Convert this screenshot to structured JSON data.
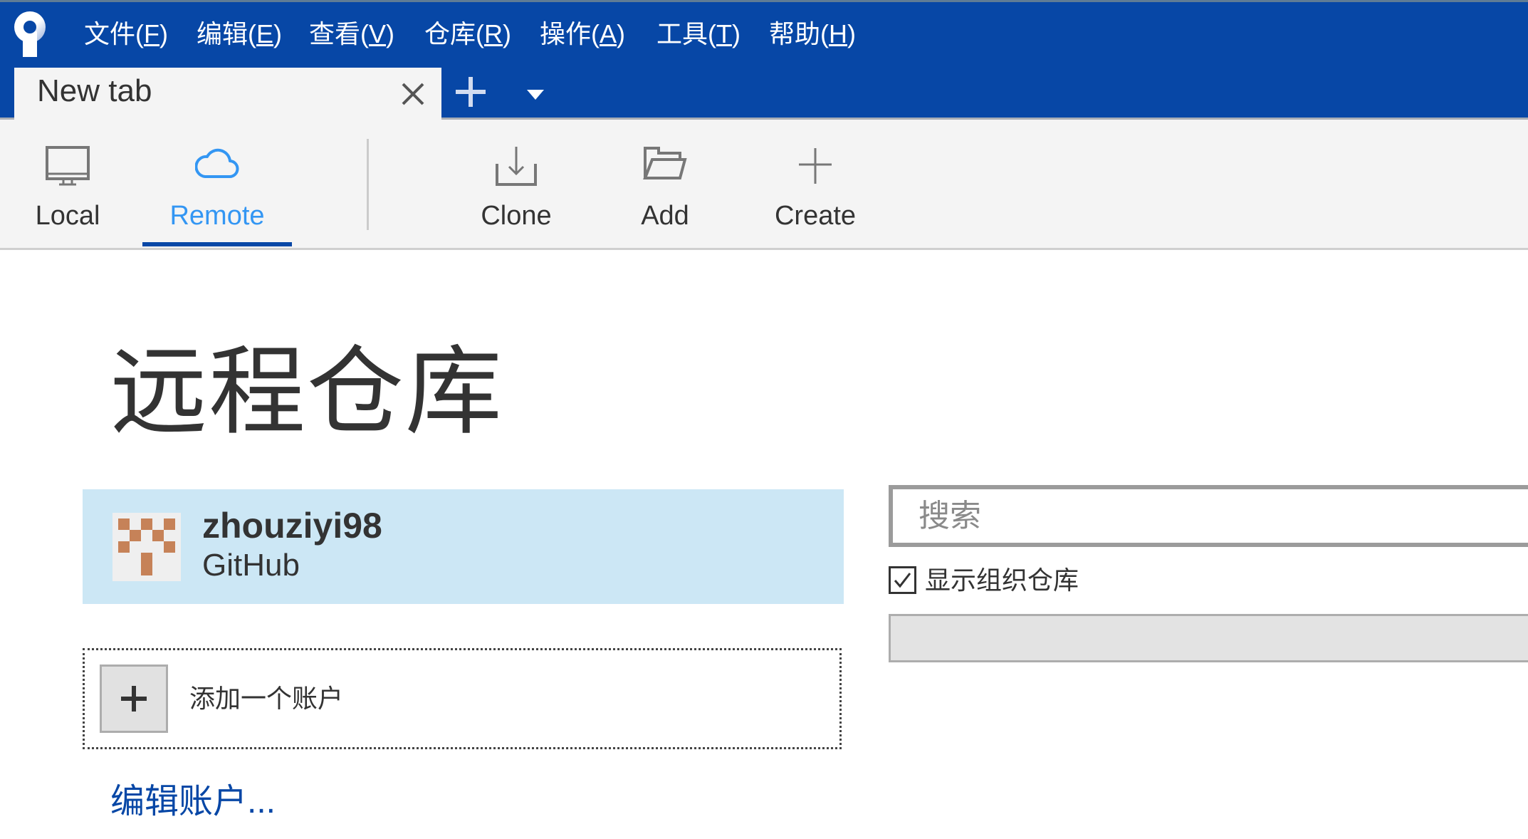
{
  "colors": {
    "chrome_blue": "#0747A6",
    "toolbar_bg": "#F4F4F4",
    "selected_account_bg": "#CCE7F5",
    "remote_accent": "#3396F3",
    "link_blue": "#0747A6",
    "avatar_orange": "#C68258"
  },
  "app": {
    "logo_icon": "sourcetree-logo-icon"
  },
  "menu": {
    "items": [
      {
        "label": "文件(F)",
        "mnemonic": "F"
      },
      {
        "label": "编辑(E)",
        "mnemonic": "E"
      },
      {
        "label": "查看(V)",
        "mnemonic": "V"
      },
      {
        "label": "仓库(R)",
        "mnemonic": "R"
      },
      {
        "label": "操作(A)",
        "mnemonic": "A"
      },
      {
        "label": "工具(T)",
        "mnemonic": "T"
      },
      {
        "label": "帮助(H)",
        "mnemonic": "H"
      }
    ]
  },
  "tabs": {
    "items": [
      {
        "label": "New tab",
        "active": true
      }
    ],
    "close_icon": "close-icon",
    "add_icon": "plus-icon",
    "dropdown_icon": "caret-down-icon"
  },
  "toolbar": {
    "local": {
      "label": "Local",
      "icon": "monitor-icon"
    },
    "remote": {
      "label": "Remote",
      "icon": "cloud-icon",
      "selected": true
    },
    "clone": {
      "label": "Clone",
      "icon": "download-icon"
    },
    "add": {
      "label": "Add",
      "icon": "folder-open-icon"
    },
    "create": {
      "label": "Create",
      "icon": "plus-icon"
    }
  },
  "main": {
    "title": "远程仓库",
    "account": {
      "name": "zhouziyi98",
      "provider": "GitHub",
      "selected": true
    },
    "add_account_label": "添加一个账户",
    "edit_accounts_label": "编辑账户...",
    "search": {
      "placeholder": "搜索",
      "value": ""
    },
    "show_org_repos": {
      "label": "显示组织仓库",
      "checked": true
    }
  }
}
